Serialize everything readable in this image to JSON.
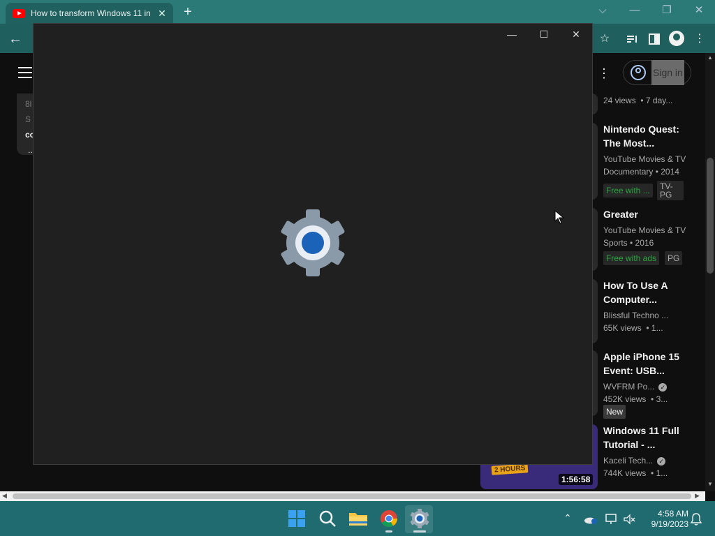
{
  "browser": {
    "tab_title": "How to transform Windows 11 in",
    "tab_close": "✕",
    "new_tab": "+"
  },
  "window_controls": {
    "minimize": "—",
    "restore": "❐",
    "close": "✕",
    "chevron": "⌵"
  },
  "youtube": {
    "sign_in": "Sign in",
    "left_card_lines": [
      "8l",
      "S",
      "co",
      "..."
    ],
    "partial_meta": {
      "views": "24 views",
      "age": "• 7 day..."
    },
    "videos": [
      {
        "title": "Nintendo Quest: The Most...",
        "line1": "YouTube Movies & TV",
        "line2": "Documentary • 2014",
        "badge1": "Free with ...",
        "badge2": "TV-PG"
      },
      {
        "title": "Greater",
        "line1": "YouTube Movies & TV",
        "line2": "Sports • 2016",
        "badge1": "Free with ads",
        "badge2": "PG"
      },
      {
        "title": "How To Use A Computer...",
        "line1": "Blissful Techno ...",
        "line2": "65K views",
        "line2b": "• 1..."
      },
      {
        "title": "Apple iPhone 15 Event: USB...",
        "line1": "WVFRM Po...",
        "line2": "452K views",
        "line2b": "• 3...",
        "badge1": "New"
      },
      {
        "title": "Windows 11 Full Tutorial - ...",
        "line1": "Kaceli Tech...",
        "line2": "744K views",
        "line2b": "• 1...",
        "thumb_label": "2 HOURS",
        "duration": "1:56:58"
      }
    ]
  },
  "settings_window": {
    "minimize": "—",
    "maximize": "☐",
    "close": "✕",
    "splash_icon": "settings-gear-icon"
  },
  "taskbar": {
    "icons": [
      "windows-start-icon",
      "search-icon",
      "file-explorer-icon",
      "chrome-icon",
      "settings-icon"
    ],
    "time": "4:58 AM",
    "date": "9/19/2023"
  },
  "colors": {
    "titlebar": "#2b7a78",
    "toolbar": "#1f5f5d",
    "youtube_bg": "#0f0f0f",
    "settings_bg": "#202020",
    "taskbar": "#1f6b70",
    "accent_blue": "#1b63b8"
  }
}
